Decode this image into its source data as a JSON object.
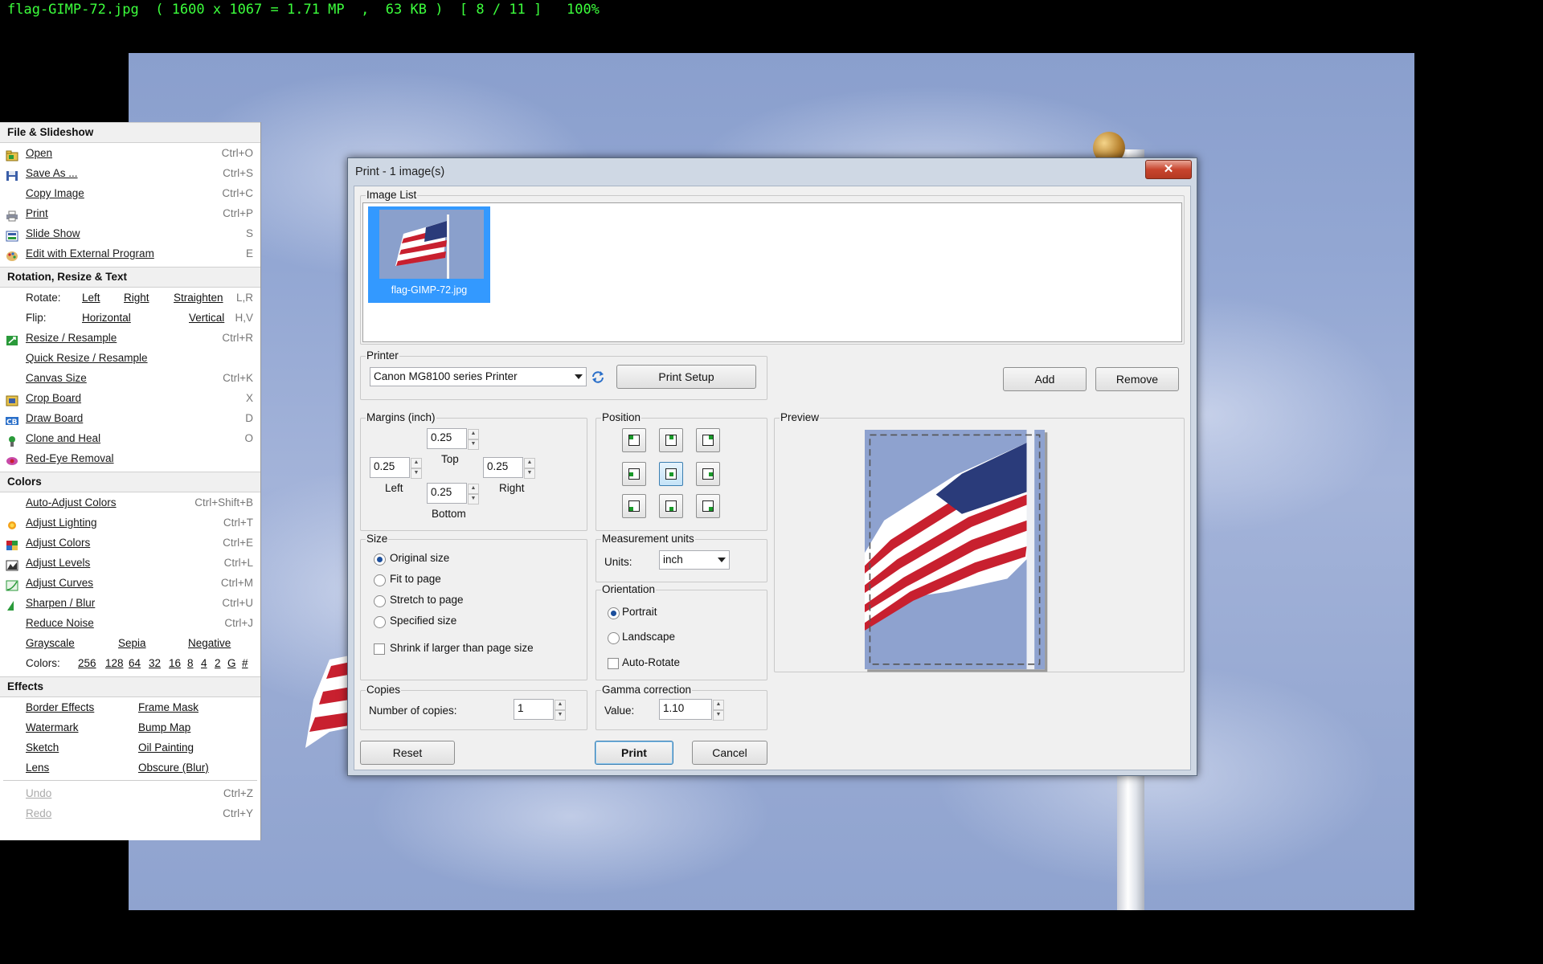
{
  "status_bar": "flag-GIMP-72.jpg  ( 1600 x 1067 = 1.71 MP  ,  63 KB )  [ 8 / 11 ]   100%",
  "menu": {
    "sections": {
      "file": "File & Slideshow",
      "rotation": "Rotation, Resize & Text",
      "colors": "Colors",
      "effects": "Effects"
    },
    "file_items": [
      {
        "label": "Open",
        "shortcut": "Ctrl+O",
        "icon": "open-folder-icon"
      },
      {
        "label": "Save As ...",
        "shortcut": "Ctrl+S",
        "icon": "floppy-disk-icon"
      },
      {
        "label": "Copy Image",
        "shortcut": "Ctrl+C",
        "icon": ""
      },
      {
        "label": "Print",
        "shortcut": "Ctrl+P",
        "icon": "printer-icon"
      },
      {
        "label": "Slide Show",
        "shortcut": "S",
        "icon": "slideshow-icon"
      },
      {
        "label": "Edit with External Program",
        "shortcut": "E",
        "icon": "palette-icon"
      }
    ],
    "rotate": {
      "label": "Rotate:",
      "left": "Left",
      "right": "Right",
      "straighten": "Straighten",
      "shortcut": "L,R"
    },
    "flip": {
      "label": "Flip:",
      "horizontal": "Horizontal",
      "vertical": "Vertical",
      "shortcut": "H,V"
    },
    "rotation_items": [
      {
        "label": "Resize / Resample",
        "shortcut": "Ctrl+R",
        "icon": "resize-icon"
      },
      {
        "label": "Quick Resize / Resample",
        "shortcut": "",
        "icon": ""
      },
      {
        "label": "Canvas Size",
        "shortcut": "Ctrl+K",
        "icon": ""
      },
      {
        "label": "Crop Board",
        "shortcut": "X",
        "icon": "crop-icon"
      },
      {
        "label": "Draw Board",
        "shortcut": "D",
        "icon": "draw-icon"
      },
      {
        "label": "Clone and Heal",
        "shortcut": "O",
        "icon": "clone-icon"
      },
      {
        "label": "Red-Eye Removal",
        "shortcut": "",
        "icon": "red-eye-icon"
      }
    ],
    "color_items": [
      {
        "label": "Auto-Adjust Colors",
        "shortcut": "Ctrl+Shift+B",
        "icon": ""
      },
      {
        "label": "Adjust Lighting",
        "shortcut": "Ctrl+T",
        "icon": "sun-icon"
      },
      {
        "label": "Adjust Colors",
        "shortcut": "Ctrl+E",
        "icon": "colors-icon"
      },
      {
        "label": "Adjust Levels",
        "shortcut": "Ctrl+L",
        "icon": "levels-icon"
      },
      {
        "label": "Adjust Curves",
        "shortcut": "Ctrl+M",
        "icon": "curves-icon"
      },
      {
        "label": "Sharpen / Blur",
        "shortcut": "Ctrl+U",
        "icon": "sharpen-icon"
      },
      {
        "label": "Reduce Noise",
        "shortcut": "Ctrl+J",
        "icon": ""
      }
    ],
    "tone": {
      "grayscale": "Grayscale",
      "sepia": "Sepia",
      "negative": "Negative"
    },
    "colors_row": {
      "label": "Colors:",
      "values": [
        "256",
        "128",
        "64",
        "32",
        "16",
        "8",
        "4",
        "2",
        "G",
        "#"
      ]
    },
    "effects_items": [
      [
        "Border Effects",
        "Frame Mask"
      ],
      [
        "Watermark",
        "Bump Map"
      ],
      [
        "Sketch",
        "Oil Painting"
      ],
      [
        "Lens",
        "Obscure (Blur)"
      ]
    ],
    "undo": {
      "label": "Undo",
      "shortcut": "Ctrl+Z"
    },
    "redo": {
      "label": "Redo",
      "shortcut": "Ctrl+Y"
    }
  },
  "dialog": {
    "title": "Print  -  1 image(s)",
    "close_symbol": "✕",
    "image_list": {
      "legend": "Image List",
      "items": [
        {
          "name": "flag-GIMP-72.jpg"
        }
      ]
    },
    "printer": {
      "legend": "Printer",
      "selected": "Canon MG8100 series Printer",
      "setup_label": "Print Setup"
    },
    "add_label": "Add",
    "remove_label": "Remove",
    "margins": {
      "legend": "Margins (inch)",
      "top": "0.25",
      "left": "0.25",
      "right": "0.25",
      "bottom": "0.25",
      "top_label": "Top",
      "left_label": "Left",
      "right_label": "Right",
      "bottom_label": "Bottom"
    },
    "position": {
      "legend": "Position",
      "selected": "center"
    },
    "preview": {
      "legend": "Preview"
    },
    "size": {
      "legend": "Size",
      "options": [
        "Original size",
        "Fit to page",
        "Stretch to page",
        "Specified size"
      ],
      "selected": "Original size",
      "shrink_label": "Shrink if larger than page size",
      "shrink_checked": false
    },
    "units": {
      "legend": "Measurement units",
      "label": "Units:",
      "value": "inch"
    },
    "orientation": {
      "legend": "Orientation",
      "portrait": "Portrait",
      "landscape": "Landscape",
      "selected": "Portrait",
      "auto_rotate": "Auto-Rotate",
      "auto_rotate_checked": false
    },
    "copies": {
      "legend": "Copies",
      "label": "Number of copies:",
      "value": "1"
    },
    "gamma": {
      "legend": "Gamma correction",
      "label": "Value:",
      "value": "1.10"
    },
    "reset_label": "Reset",
    "print_label": "Print",
    "cancel_label": "Cancel"
  },
  "colors": {
    "status_text": "#3cff3c",
    "selection": "#3399ff",
    "accent": "#1c4f9c"
  }
}
